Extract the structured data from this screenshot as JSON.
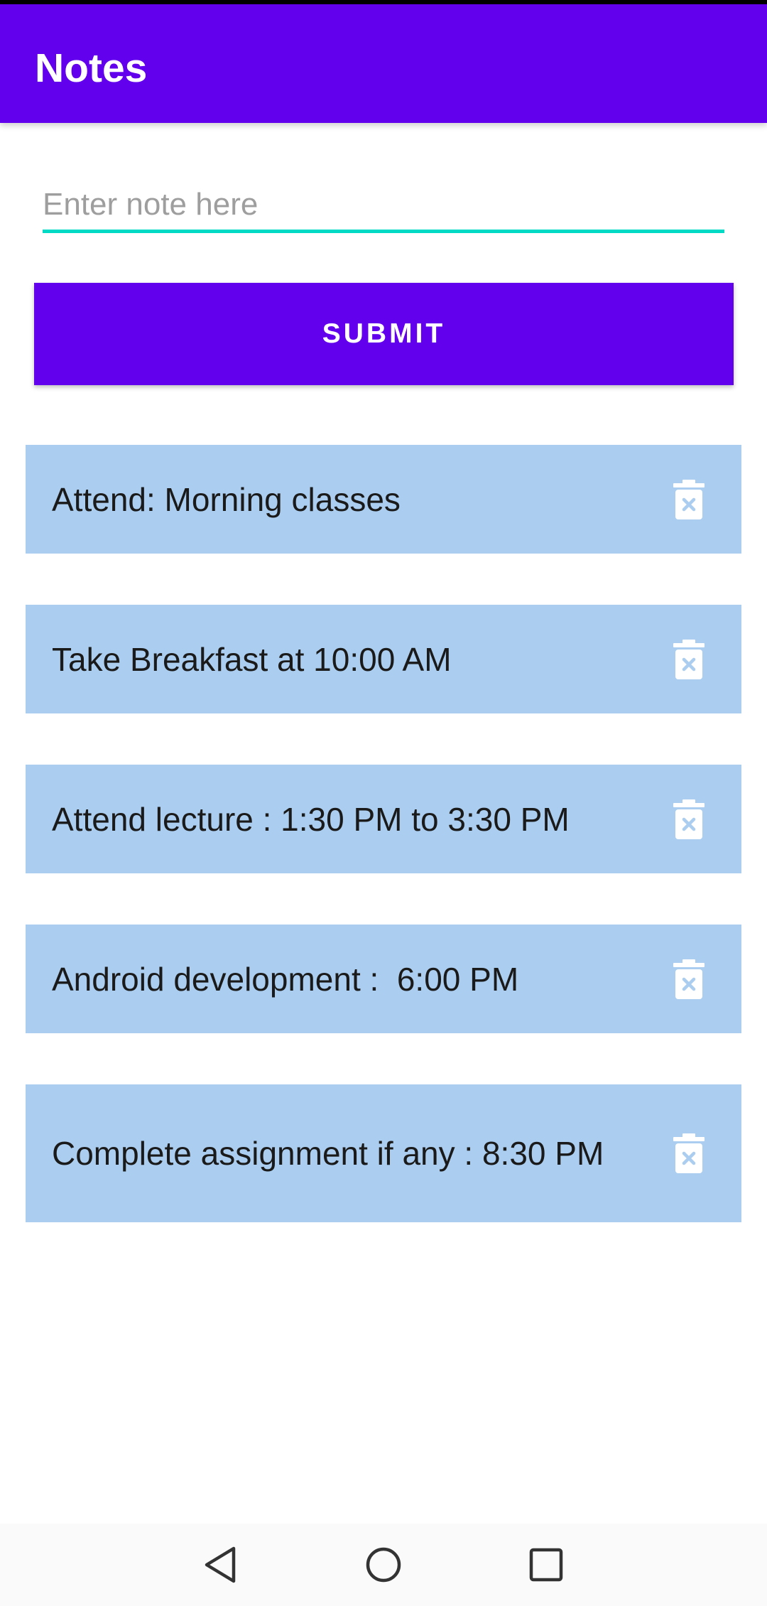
{
  "app_bar": {
    "title": "Notes",
    "color": "#6200EE"
  },
  "input": {
    "value": "",
    "placeholder": "Enter note here",
    "underline_color": "#03DAC5"
  },
  "submit": {
    "label": "SUBMIT"
  },
  "notes": [
    {
      "text": "Attend: Morning classes",
      "icon": "trash-icon"
    },
    {
      "text": "Take Breakfast at 10:00 AM",
      "icon": "trash-icon"
    },
    {
      "text": "Attend lecture : 1:30 PM to 3:30 PM",
      "icon": "trash-icon"
    },
    {
      "text": "Android development :  6:00 PM",
      "icon": "trash-icon"
    },
    {
      "text": "Complete assignment if any : 8:30 PM",
      "icon": "trash-icon"
    }
  ],
  "note_card_color": "#ABCDEF",
  "nav_bar": {
    "buttons": [
      "back-icon",
      "home-icon",
      "recents-icon"
    ]
  }
}
